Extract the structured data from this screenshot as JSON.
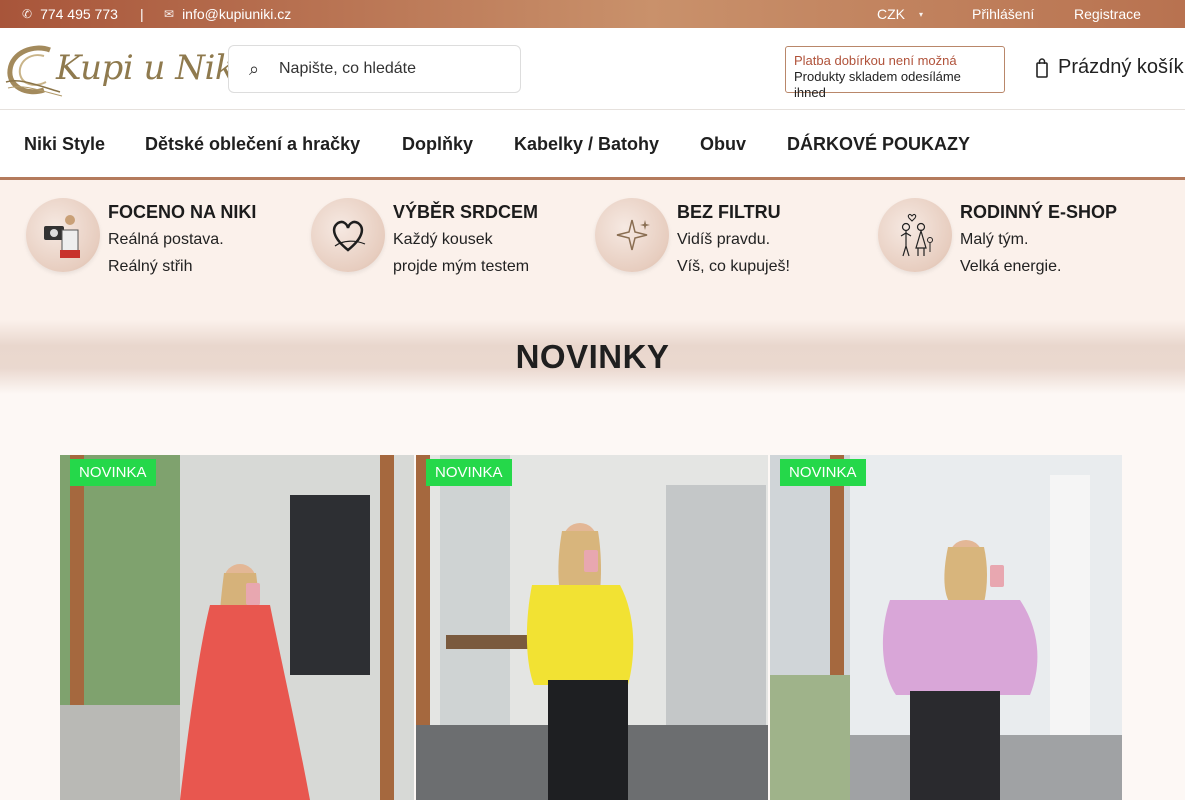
{
  "topbar": {
    "phone": "774 495 773",
    "separator": "|",
    "email": "info@kupiuniki.cz",
    "currency": "CZK",
    "login": "Přihlášení",
    "register": "Registrace"
  },
  "header": {
    "logo_text": "Kupi u Niki",
    "search_placeholder": "Napište, co hledáte",
    "notice_line1": "Platba dobírkou není možná",
    "notice_line2": "Produkty skladem odesíláme ihned",
    "cart_label": "Prázdný košík"
  },
  "nav": {
    "items": [
      "Niki Style",
      "Dětské oblečení a hračky",
      "Doplňky",
      "Kabelky / Batohy",
      "Obuv",
      "DÁRKOVÉ POUKAZY"
    ]
  },
  "features": [
    {
      "title": "FOCENO NA NIKI",
      "line1": "Reálná postava.",
      "line2": "Reálný střih",
      "icon": "camera-icon"
    },
    {
      "title": "VÝBĚR SRDCEM",
      "line1": "Každý kousek",
      "line2": "projde mým testem",
      "icon": "heart-icon"
    },
    {
      "title": "BEZ FILTRU",
      "line1": "Vidíš pravdu.",
      "line2": "Víš, co kupuješ!",
      "icon": "sparkle-icon"
    },
    {
      "title": "RODINNÝ E-SHOP",
      "line1": "Malý tým.",
      "line2": "Velká energie.",
      "icon": "family-icon"
    }
  ],
  "section_title": "NOVINKY",
  "products": [
    {
      "badge": "NOVINKA",
      "color": "#e8574f"
    },
    {
      "badge": "NOVINKA",
      "color": "#f2e233"
    },
    {
      "badge": "NOVINKA",
      "color": "#d9a6d8"
    }
  ],
  "colors": {
    "accent": "#b47a5c",
    "badge": "#25d84a",
    "topbar": "#a8553a"
  }
}
